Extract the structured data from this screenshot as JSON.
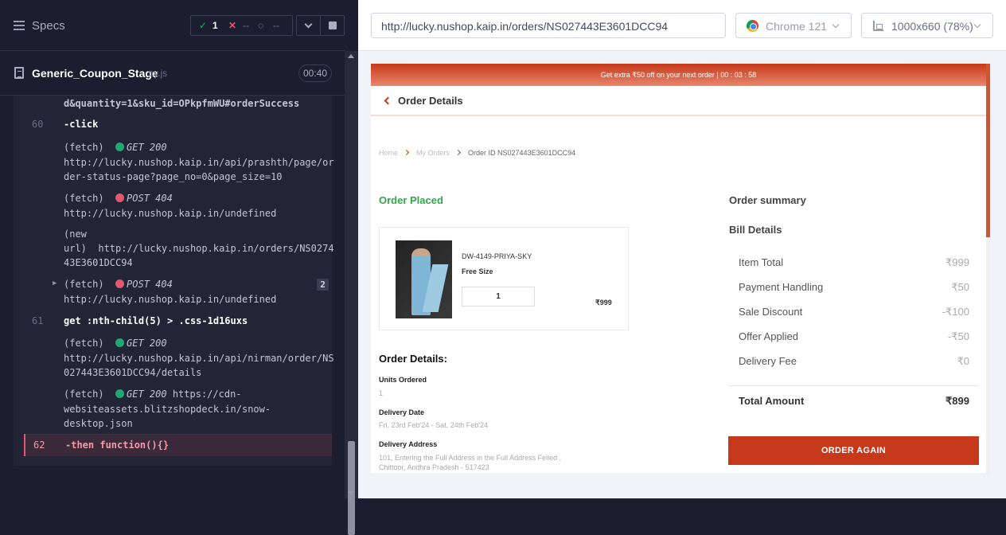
{
  "runner": {
    "specs_label": "Specs",
    "stats": {
      "passed": "1",
      "failed": "--",
      "pending": "--"
    },
    "file": {
      "name": "Generic_Coupon_Stage",
      "ext": "cy.js",
      "duration": "00:40"
    },
    "log": {
      "line0": "d&quantity=1&sku_id=OPkpfmWU#orderSuccess",
      "l60": "60",
      "c60": "-click",
      "f1_pre": "(fetch)",
      "f1_method": "GET 200",
      "f1_url": "http://lucky.nushop.kaip.in/api/prashth/page/or\nder-status-page?page_no=0&page_size=10",
      "f2_pre": "(fetch)",
      "f2_method": "POST 404",
      "f2_url": "http://lucky.nushop.kaip.in/undefined",
      "nu": "(new\nurl)  http://lucky.nushop.kaip.in/orders/NS0274\n43E3601DCC94",
      "f3_pre": "(fetch)",
      "f3_method": "POST 404",
      "f3_url": "http://lucky.nushop.kaip.in/undefined",
      "f3_badge": "2",
      "l61": "61",
      "c61": "get  :nth-child(5) > .css-1d16uxs",
      "f4_pre": "(fetch)",
      "f4_method": "GET 200",
      "f4_url": "http://lucky.nushop.kaip.in/api/nirman/order/NS\n027443E3601DCC94/details",
      "f5_pre": "(fetch)",
      "f5_method": "GET 200",
      "f5_url_a": " https://cdn-",
      "f5_url_b": "websiteassets.blitzshopdeck.in/snow-\ndesktop.json",
      "l62": "62",
      "c62": "-then  function(){}"
    }
  },
  "browser": {
    "url": "http://lucky.nushop.kaip.in/orders/NS027443E3601DCC94",
    "name": "Chrome 121",
    "viewport": "1000x660  (78%)"
  },
  "app": {
    "promo": "Get extra ₹50 off on your next order | 00 : 03 : 58",
    "header_title": "Order Details",
    "breadcrumb": {
      "home": "Home",
      "orders": "My Orders",
      "current": "Order ID NS027443E3601DCC94"
    },
    "status": "Order Placed",
    "product": {
      "sku": "DW-4149-PRIYA-SKY",
      "size": "Free Size",
      "qty": "1",
      "price": "₹999"
    },
    "details": {
      "title": "Order Details:",
      "units_label": "Units Ordered",
      "units_value": "1",
      "date_label": "Delivery Date",
      "date_value": "Fri, 23rd Feb'24 - Sat, 24th Feb'24",
      "addr_label": "Delivery Address",
      "addr_value": "101, Entering the Full Address in the Full Address Feiled ,\nChittoor, Andhra Pradesh - 517423"
    },
    "summary": {
      "title": "Order summary",
      "bill_title": "Bill Details",
      "rows": [
        {
          "label": "Item Total",
          "value": "₹999"
        },
        {
          "label": "Payment Handling",
          "value": "₹50"
        },
        {
          "label": "Sale Discount",
          "value": "-₹100"
        },
        {
          "label": "Offer Applied",
          "value": "-₹50"
        },
        {
          "label": "Delivery Fee",
          "value": "₹0"
        }
      ],
      "total_label": "Total Amount",
      "total_value": "₹899"
    },
    "cta": "ORDER AGAIN"
  },
  "colors": {
    "accent": "#c5391a",
    "success": "#33a54a",
    "runner_bg": "#1b1e2e"
  }
}
